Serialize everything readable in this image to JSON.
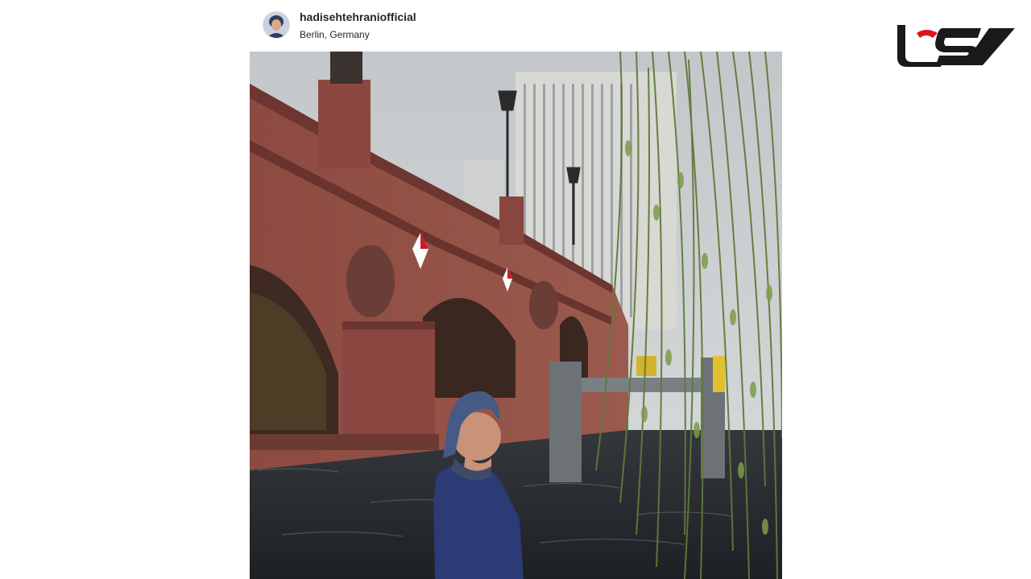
{
  "post": {
    "username": "hadisehtehraniofficial",
    "location": "Berlin, Germany"
  },
  "logo": {
    "icon": "site-logo",
    "color": "#1a1a1a",
    "accent": "#e0141c"
  },
  "photo": {
    "subject": "woman-by-bridge-photo"
  }
}
